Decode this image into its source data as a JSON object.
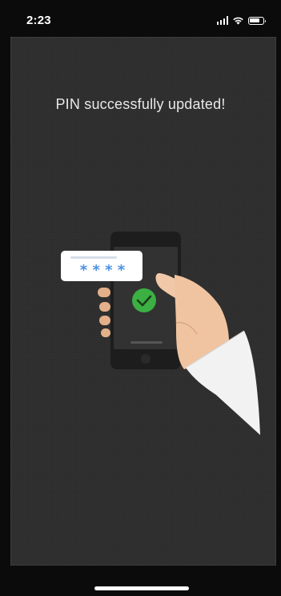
{
  "status_bar": {
    "time": "2:23"
  },
  "main": {
    "message": "PIN successfully updated!",
    "pin_display": "* * * *",
    "illustration_icon": "hand-holding-phone-with-checkmark"
  },
  "colors": {
    "background": "#0b0b0b",
    "panel": "#2e2e2e",
    "text": "#e8e8e8",
    "pin_star": "#4a90e2",
    "success_green": "#3cb043",
    "phone_body": "#1d1d1d",
    "skin": "#f2c9a8",
    "sleeve": "#f2f2f2"
  }
}
